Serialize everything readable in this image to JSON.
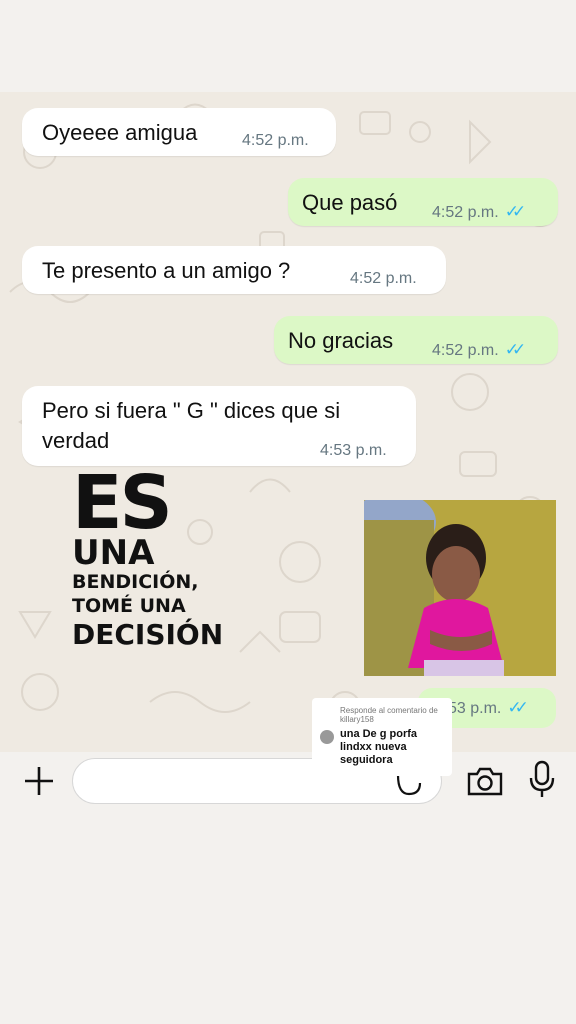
{
  "messages": [
    {
      "text": "Oyeeee amigua",
      "time": "4:52 p.m.",
      "dir": "in"
    },
    {
      "text": "Que pasó",
      "time": "4:52 p.m.",
      "dir": "out",
      "read": true
    },
    {
      "text": "Te presento a un amigo ?",
      "time": "4:52 p.m.",
      "dir": "in"
    },
    {
      "text": "No gracias",
      "time": "4:52 p.m.",
      "dir": "out",
      "read": true
    },
    {
      "text_line1": "Pero si fuera \" G \" dices que si",
      "text_line2": "verdad",
      "time": "4:53 p.m.",
      "dir": "in"
    }
  ],
  "sticker": {
    "line1": "ES",
    "line2": "UNA",
    "line3": "BENDICIÓN,",
    "line4": "TOMÉ UNA",
    "line5": "DECISIÓN"
  },
  "photo_message": {
    "time_visible": "53 p.m.",
    "read": true,
    "image": "crying-girl-photo"
  },
  "reply_overlay": {
    "header": "Responde al comentario de",
    "user": "killary158",
    "text_line1": "una De g porfa",
    "text_line2": "lindxx nueva",
    "text_line3": "seguidora"
  },
  "icons": {
    "plus": "plus-icon",
    "sticker": "sticker-icon",
    "camera": "camera-icon",
    "mic": "microphone-icon"
  },
  "colors": {
    "outgoing": "#dcf8c6",
    "incoming": "#ffffff",
    "ticks": "#34b7f1",
    "time": "#667781"
  }
}
